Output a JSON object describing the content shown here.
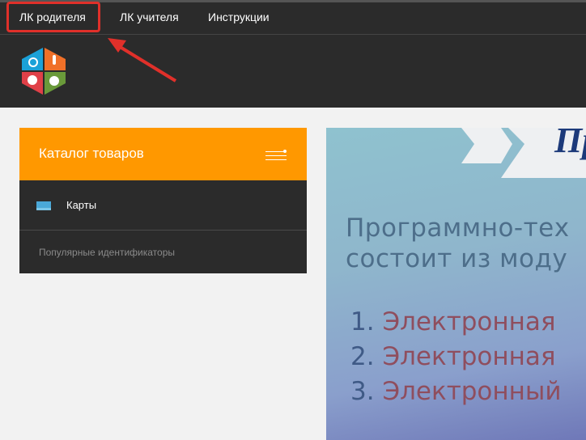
{
  "topnav": {
    "items": [
      {
        "label": "ЛК родителя",
        "highlighted": true
      },
      {
        "label": "ЛК учителя"
      },
      {
        "label": "Инструкции"
      }
    ]
  },
  "annotation": {
    "highlight_color": "#e0302a",
    "arrow_color": "#e0302a"
  },
  "catalog": {
    "title": "Каталог товаров",
    "accent": "#ff9800",
    "items": [
      {
        "label": "Карты",
        "icon": "card-icon"
      }
    ],
    "section": "Популярные идентификаторы"
  },
  "banner": {
    "title": "Пр",
    "lines": [
      "Программно-тех",
      "состоит из моду"
    ],
    "list": [
      {
        "num": "1.",
        "text": "Электронная"
      },
      {
        "num": "2.",
        "text": "Электронная"
      },
      {
        "num": "3.",
        "text": "Электронный"
      }
    ]
  }
}
